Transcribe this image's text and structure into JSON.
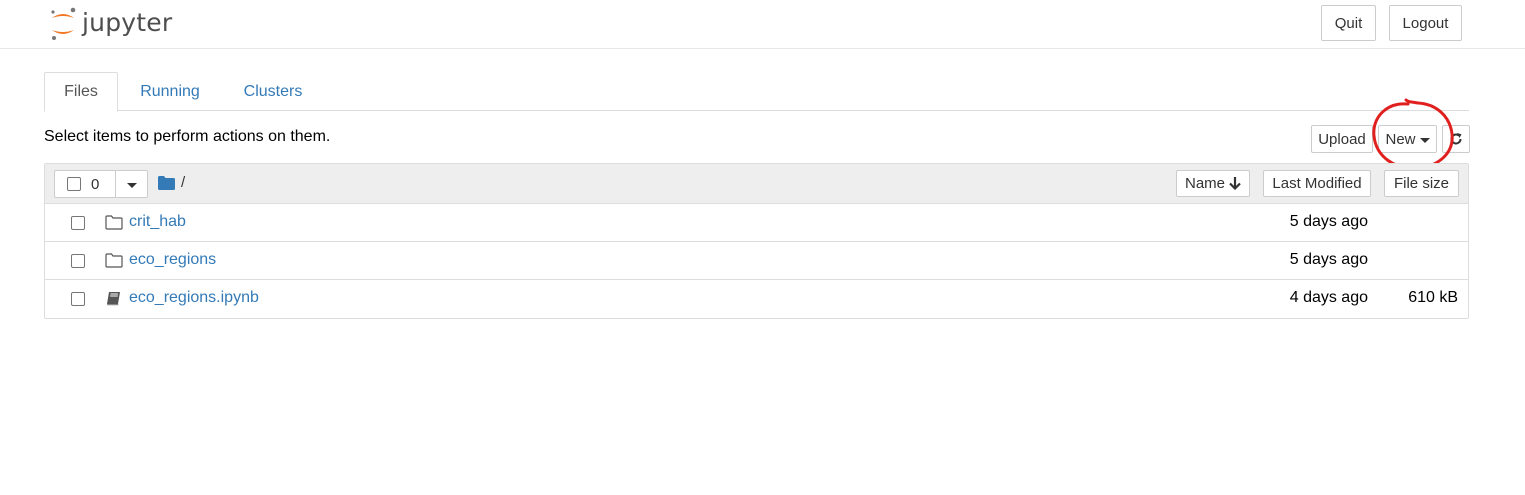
{
  "header": {
    "logo_text": "jupyter",
    "quit_label": "Quit",
    "logout_label": "Logout"
  },
  "tabs": [
    {
      "label": "Files",
      "active": true
    },
    {
      "label": "Running",
      "active": false
    },
    {
      "label": "Clusters",
      "active": false
    }
  ],
  "toolbar": {
    "instructions": "Select items to perform actions on them.",
    "upload_label": "Upload",
    "new_label": "New",
    "refresh_icon": "refresh-icon"
  },
  "list_header": {
    "selected_count": "0",
    "path": "/",
    "sort_name_label": "Name",
    "sort_modified_label": "Last Modified",
    "sort_size_label": "File size"
  },
  "files": [
    {
      "name": "crit_hab",
      "type": "folder",
      "modified": "5 days ago",
      "size": ""
    },
    {
      "name": "eco_regions",
      "type": "folder",
      "modified": "5 days ago",
      "size": ""
    },
    {
      "name": "eco_regions.ipynb",
      "type": "notebook",
      "modified": "4 days ago",
      "size": "610 kB"
    }
  ],
  "colors": {
    "link": "#337ab7",
    "logo_orange": "#f37726",
    "annotation": "#e0201e"
  }
}
